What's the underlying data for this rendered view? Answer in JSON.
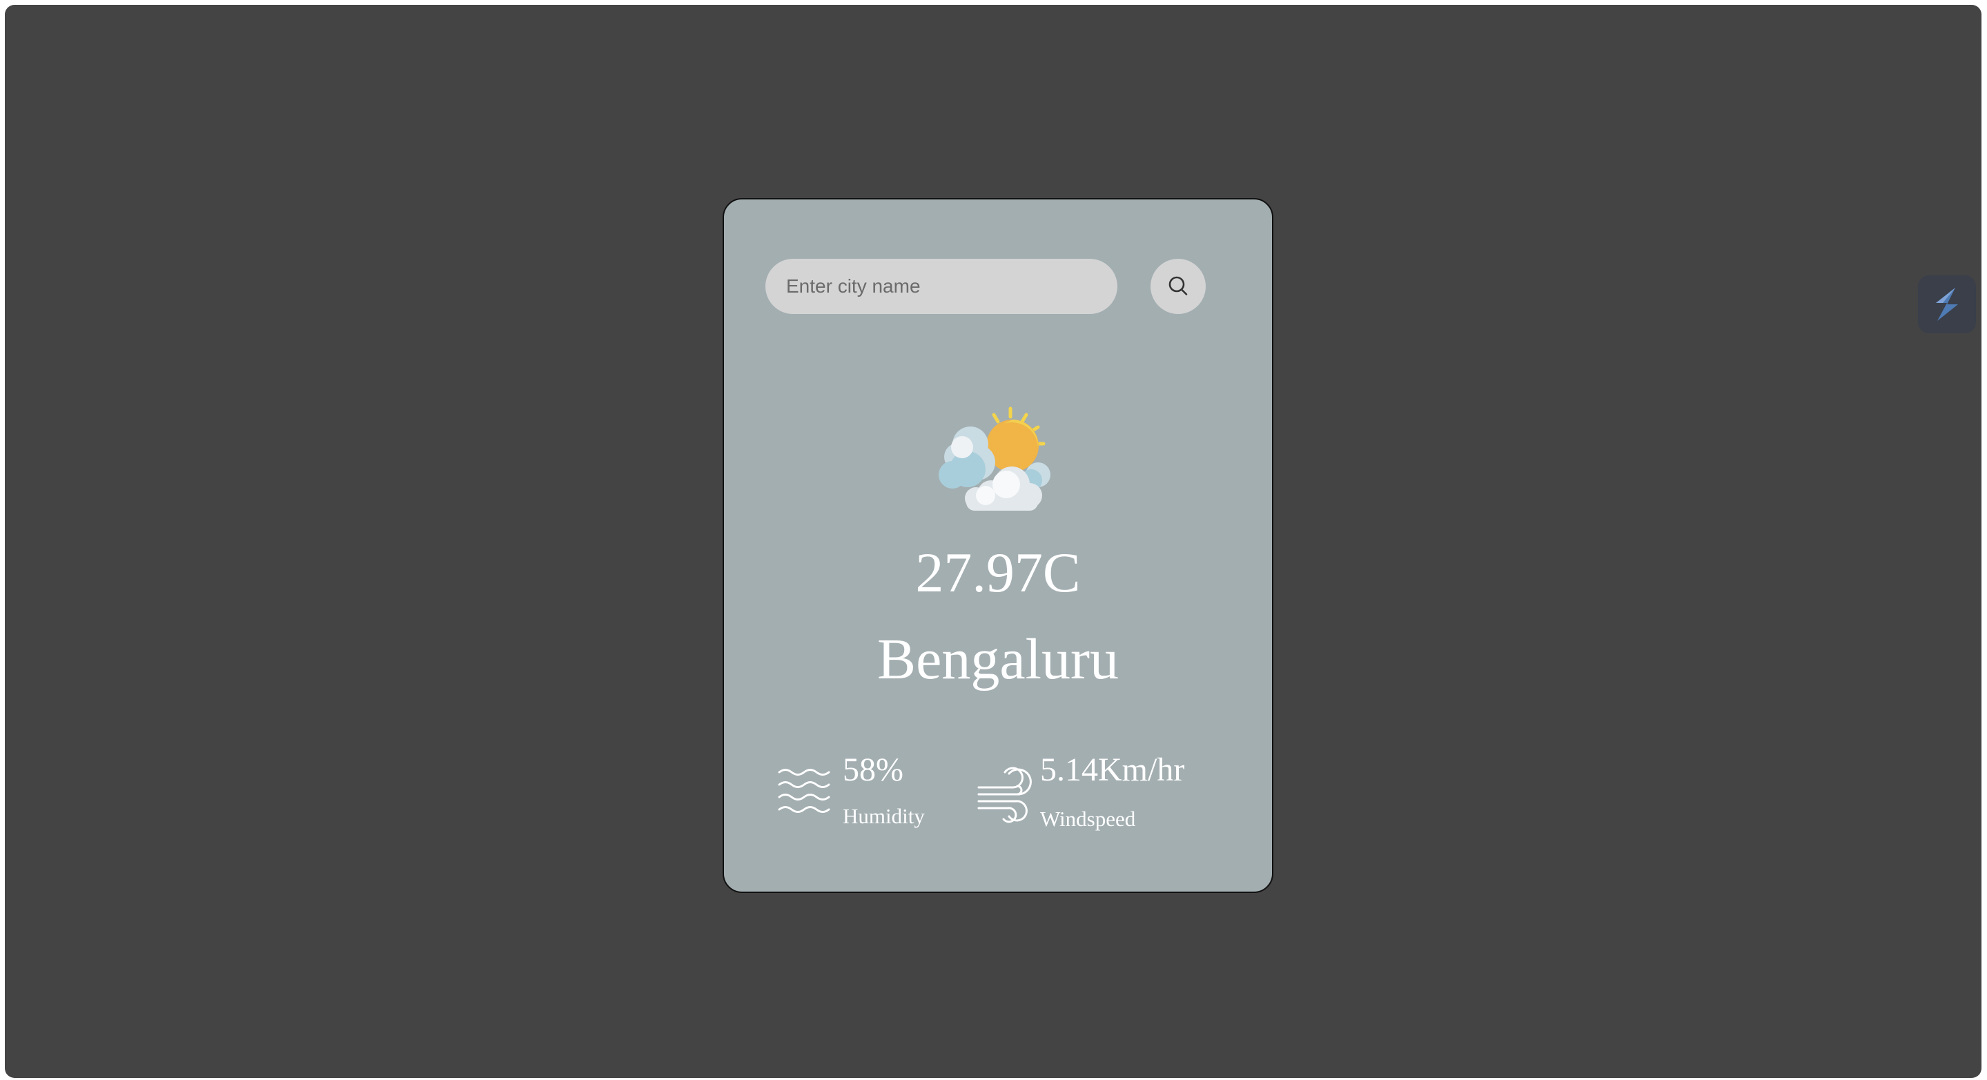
{
  "search": {
    "placeholder": "Enter city name",
    "value": ""
  },
  "weather": {
    "icon": "partly-cloudy-icon",
    "temperature": "27.97C",
    "city": "Bengaluru"
  },
  "details": {
    "humidity": {
      "icon": "humidity-waves-icon",
      "value": "58%",
      "label": "Humidity"
    },
    "wind": {
      "icon": "wind-icon",
      "value": "5.14Km/hr",
      "label": "Windspeed"
    }
  },
  "extension": {
    "icon": "extension-lightning-icon"
  },
  "colors": {
    "page_background": "#444444",
    "card_background": "#a3aeb1",
    "input_background": "#d4d4d4",
    "text": "#ffffff"
  }
}
